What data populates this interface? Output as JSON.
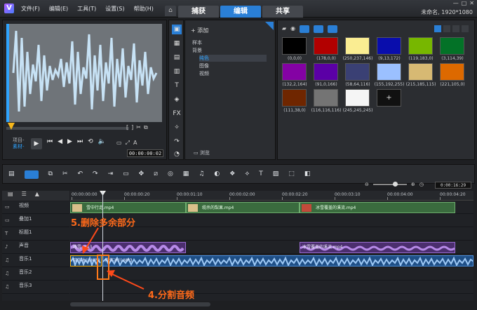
{
  "menu": [
    "文件(F)",
    "编辑(E)",
    "工具(T)",
    "设置(S)",
    "帮助(H)"
  ],
  "main_tabs": [
    "捕获",
    "编辑",
    "共享"
  ],
  "project_info": "未命名, 1920*1080",
  "player": {
    "mode_project": "项目-",
    "mode_clip": "素材-",
    "timecode": "00:00:00:02"
  },
  "library": {
    "add_label": "添加",
    "tree": [
      "样本",
      "背景",
      "纯色",
      "图像",
      "视频"
    ],
    "browse_label": "浏览",
    "swatches": [
      {
        "label": "(0,0,0)",
        "color": "#000000"
      },
      {
        "label": "(178,0,0)",
        "color": "#b20000"
      },
      {
        "label": "(250,237,146)",
        "color": "#faed92"
      },
      {
        "label": "(9,13,172)",
        "color": "#090dac"
      },
      {
        "label": "(119,183,0)",
        "color": "#77b700"
      },
      {
        "label": "(3,114,39)",
        "color": "#037227"
      },
      {
        "label": "(132,2,164)",
        "color": "#8402a4"
      },
      {
        "label": "(91,0,166)",
        "color": "#5b00a6"
      },
      {
        "label": "(58,64,116)",
        "color": "#3a4074"
      },
      {
        "label": "(155,192,255)",
        "color": "#9bc0ff"
      },
      {
        "label": "(215,185,115)",
        "color": "#d7b973"
      },
      {
        "label": "(221,105,0)",
        "color": "#dd6900"
      },
      {
        "label": "(111,38,0)",
        "color": "#6f2600"
      },
      {
        "label": "(116,116,116)",
        "color": "#747474"
      },
      {
        "label": "(245,245,245)",
        "color": "#f5f5f5"
      }
    ]
  },
  "timeline": {
    "timecode": "0:00:16:29",
    "ruler": [
      "00:00:00:00",
      "00:00:00:20",
      "00:00:01:10",
      "00:00:02:00",
      "00:00:02:20",
      "00:00:03:10",
      "00:00:04:00",
      "00:00:04:20"
    ],
    "tracks": [
      {
        "name": "视频"
      },
      {
        "name": "叠加1"
      },
      {
        "name": "标题1"
      },
      {
        "name": "声音"
      },
      {
        "name": "音乐1"
      },
      {
        "name": "音乐2"
      },
      {
        "name": "音乐3"
      }
    ],
    "video_clips": [
      "雪中行走.mp4",
      "缆杀的梨果.mp4",
      "冰雪覆盖的溪流.mp4"
    ],
    "voice_clips": [
      "路雪.mp3",
      "冰雪覆盖的溪流.mp4"
    ],
    "music_clips": [
      "陪伴冰川.MP3",
      "陪伴冰川.MP3"
    ]
  },
  "annotations": {
    "delete_step": "5.删除多余部分",
    "split_step": "4.分割音频"
  },
  "colors": {
    "accent": "#2a7fd6",
    "annotation": "#ff6a1a"
  }
}
